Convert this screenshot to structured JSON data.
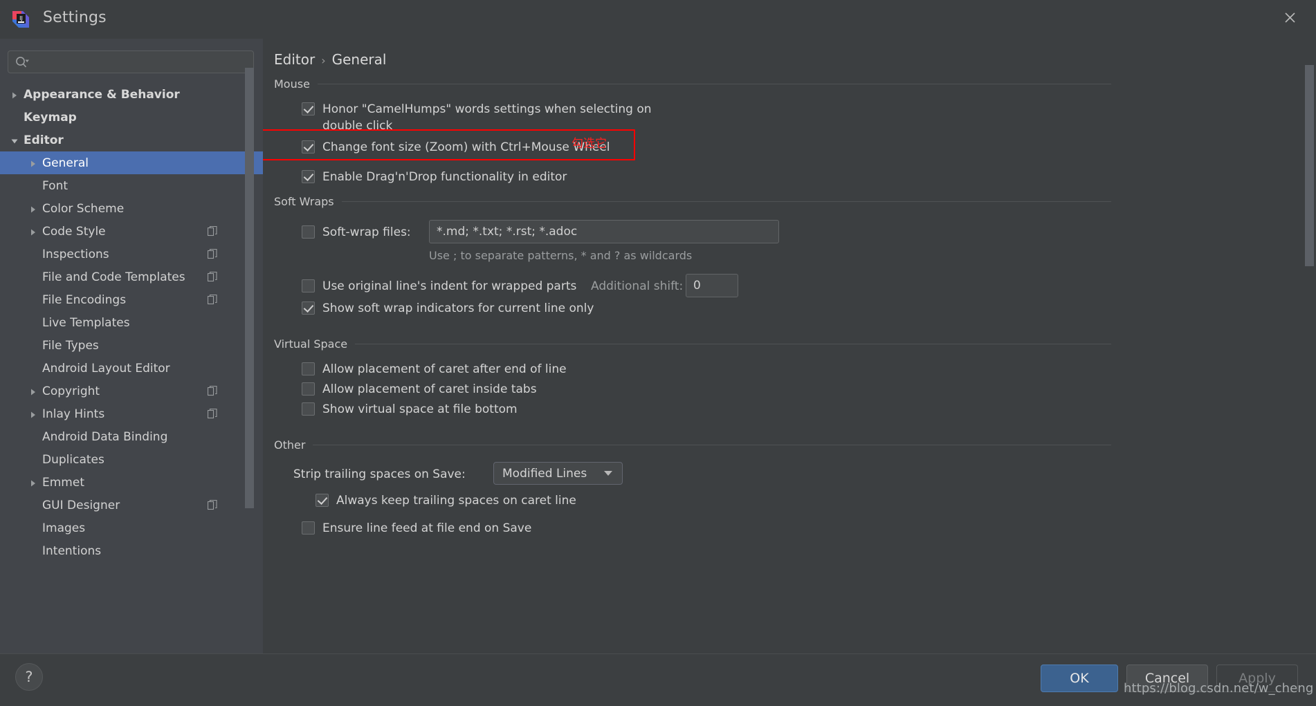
{
  "window": {
    "title": "Settings",
    "app_icon": "intellij-idea-icon",
    "close_icon": "close-icon"
  },
  "sidebar": {
    "search": {
      "placeholder": "",
      "value": "",
      "icon": "search-icon"
    },
    "items": [
      {
        "label": "Appearance & Behavior",
        "arrow": "collapsed",
        "indent": 0,
        "bold": true,
        "copy": false,
        "selected": false
      },
      {
        "label": "Keymap",
        "arrow": "none",
        "indent": 0,
        "bold": true,
        "copy": false,
        "selected": false
      },
      {
        "label": "Editor",
        "arrow": "expanded",
        "indent": 0,
        "bold": true,
        "copy": false,
        "selected": false
      },
      {
        "label": "General",
        "arrow": "collapsed",
        "indent": 1,
        "bold": false,
        "copy": false,
        "selected": true
      },
      {
        "label": "Font",
        "arrow": "none",
        "indent": 1,
        "bold": false,
        "copy": false,
        "selected": false
      },
      {
        "label": "Color Scheme",
        "arrow": "collapsed",
        "indent": 1,
        "bold": false,
        "copy": false,
        "selected": false
      },
      {
        "label": "Code Style",
        "arrow": "collapsed",
        "indent": 1,
        "bold": false,
        "copy": true,
        "selected": false
      },
      {
        "label": "Inspections",
        "arrow": "none",
        "indent": 1,
        "bold": false,
        "copy": true,
        "selected": false
      },
      {
        "label": "File and Code Templates",
        "arrow": "none",
        "indent": 1,
        "bold": false,
        "copy": true,
        "selected": false
      },
      {
        "label": "File Encodings",
        "arrow": "none",
        "indent": 1,
        "bold": false,
        "copy": true,
        "selected": false
      },
      {
        "label": "Live Templates",
        "arrow": "none",
        "indent": 1,
        "bold": false,
        "copy": false,
        "selected": false
      },
      {
        "label": "File Types",
        "arrow": "none",
        "indent": 1,
        "bold": false,
        "copy": false,
        "selected": false
      },
      {
        "label": "Android Layout Editor",
        "arrow": "none",
        "indent": 1,
        "bold": false,
        "copy": false,
        "selected": false
      },
      {
        "label": "Copyright",
        "arrow": "collapsed",
        "indent": 1,
        "bold": false,
        "copy": true,
        "selected": false
      },
      {
        "label": "Inlay Hints",
        "arrow": "collapsed",
        "indent": 1,
        "bold": false,
        "copy": true,
        "selected": false
      },
      {
        "label": "Android Data Binding",
        "arrow": "none",
        "indent": 1,
        "bold": false,
        "copy": false,
        "selected": false
      },
      {
        "label": "Duplicates",
        "arrow": "none",
        "indent": 1,
        "bold": false,
        "copy": false,
        "selected": false
      },
      {
        "label": "Emmet",
        "arrow": "collapsed",
        "indent": 1,
        "bold": false,
        "copy": false,
        "selected": false
      },
      {
        "label": "GUI Designer",
        "arrow": "none",
        "indent": 1,
        "bold": false,
        "copy": true,
        "selected": false
      },
      {
        "label": "Images",
        "arrow": "none",
        "indent": 1,
        "bold": false,
        "copy": false,
        "selected": false
      },
      {
        "label": "Intentions",
        "arrow": "none",
        "indent": 1,
        "bold": false,
        "copy": false,
        "selected": false
      }
    ]
  },
  "breadcrumb": {
    "parent": "Editor",
    "separator": "›",
    "current": "General"
  },
  "sections": {
    "mouse": {
      "title": "Mouse",
      "honor_camelhumps": {
        "label": "Honor \"CamelHumps\" words settings when selecting on double click",
        "checked": true
      },
      "change_font_size": {
        "label": "Change font size (Zoom) with Ctrl+Mouse Wheel",
        "checked": true
      },
      "drag_n_drop": {
        "label": "Enable Drag'n'Drop functionality in editor",
        "checked": true
      }
    },
    "soft_wraps": {
      "title": "Soft Wraps",
      "soft_wrap_files": {
        "label": "Soft-wrap files:",
        "checked": false,
        "value": "*.md; *.txt; *.rst; *.adoc"
      },
      "hint": "Use ; to separate patterns, * and ? as wildcards",
      "use_original_indent": {
        "label": "Use original line's indent for wrapped parts",
        "checked": false
      },
      "additional_shift": {
        "label": "Additional shift:",
        "value": "0"
      },
      "show_indicators": {
        "label": "Show soft wrap indicators for current line only",
        "checked": true
      }
    },
    "virtual_space": {
      "title": "Virtual Space",
      "caret_after_eol": {
        "label": "Allow placement of caret after end of line",
        "checked": false
      },
      "caret_inside_tabs": {
        "label": "Allow placement of caret inside tabs",
        "checked": false
      },
      "virtual_space_bottom": {
        "label": "Show virtual space at file bottom",
        "checked": false
      }
    },
    "other": {
      "title": "Other",
      "strip_trailing": {
        "label": "Strip trailing spaces on Save:",
        "value": "Modified Lines"
      },
      "keep_trailing_caret": {
        "label": "Always keep trailing spaces on caret line",
        "checked": true
      },
      "ensure_line_feed": {
        "label": "Ensure line feed at file end on Save",
        "checked": false
      }
    }
  },
  "annotation": {
    "text": "勾选它",
    "color": "#ff0000"
  },
  "footer": {
    "help": "?",
    "ok": "OK",
    "cancel": "Cancel",
    "apply": "Apply"
  },
  "watermark": "https://blog.csdn.net/w_cheng",
  "colors": {
    "window_bg": "#3c3f41",
    "sidebar_bg": "#42454a",
    "selection": "#4b6eaf",
    "accent_button": "#3c628f",
    "annotation_red": "#ff0000"
  }
}
